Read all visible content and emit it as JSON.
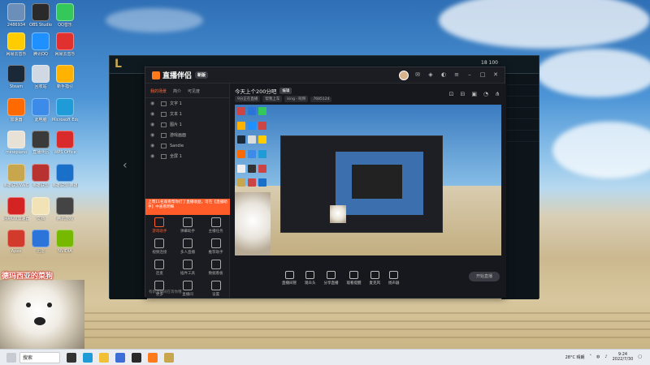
{
  "desktop": {
    "icons": [
      {
        "label": "2486934",
        "color": "#6b8fb8",
        "pos": "c1r1"
      },
      {
        "label": "OBS Studio",
        "color": "#2a2a2a",
        "pos": "c2r1"
      },
      {
        "label": "QQ音乐",
        "color": "#34c759",
        "pos": "c3r1"
      },
      {
        "label": "网易云音乐",
        "color": "#ffcc00",
        "pos": "c1r2"
      },
      {
        "label": "腾讯QQ",
        "color": "#1e90ff",
        "pos": "c2r2"
      },
      {
        "label": "网易云音乐",
        "color": "#e0312f",
        "pos": "c3r2"
      },
      {
        "label": "Steam",
        "color": "#1b2838",
        "pos": "c1r3"
      },
      {
        "label": "回收站",
        "color": "#cfd8e3",
        "pos": "c2r3"
      },
      {
        "label": "新手指引",
        "color": "#ffb300",
        "pos": "c3r3"
      },
      {
        "label": "加速器",
        "color": "#ff6a00",
        "pos": "c1r4"
      },
      {
        "label": "此电脑",
        "color": "#3d8be8",
        "pos": "c2r4"
      },
      {
        "label": "Microsoft Edge",
        "color": "#1f9bd8",
        "pos": "c3r4"
      },
      {
        "label": "minepiano",
        "color": "#e8e2d6",
        "pos": "c1r5"
      },
      {
        "label": "直播伴侣",
        "color": "#3a3a3a",
        "pos": "c2r5"
      },
      {
        "label": "WPS Office",
        "color": "#d92b2b",
        "pos": "c3r5"
      },
      {
        "label": "英雄联盟WeGame版",
        "color": "#c8a64e",
        "pos": "c1r6"
      },
      {
        "label": "英雄联盟",
        "color": "#b83232",
        "pos": "c2r6"
      },
      {
        "label": "英雄联盟·英雄时刻",
        "color": "#1a6fc9",
        "pos": "c3r6"
      },
      {
        "label": "网易UU加速器",
        "color": "#d42323",
        "pos": "c1r7"
      },
      {
        "label": "文档",
        "color": "#f2e3b6",
        "pos": "c2r7"
      },
      {
        "label": "腾讯游戏",
        "color": "#444",
        "pos": "c3r7"
      },
      {
        "label": "Apex",
        "color": "#d23b2b",
        "pos": "c1r8"
      },
      {
        "label": "迅雷",
        "color": "#2b74d9",
        "pos": "c2r8"
      },
      {
        "label": "NVIDIA",
        "color": "#76b900",
        "pos": "c3r8"
      }
    ]
  },
  "lol_client": {
    "logo": "L",
    "status": "18 100"
  },
  "app": {
    "brand": "直播伴侣",
    "version": "新版",
    "tabs": [
      "我的场景",
      "简介",
      "可见度"
    ],
    "scenes": [
      {
        "label": "文字 1"
      },
      {
        "label": "文本 1"
      },
      {
        "label": "图片 1"
      },
      {
        "label": "游戏画面"
      },
      {
        "label": "Sandie"
      },
      {
        "label": "全屏 1"
      }
    ],
    "promo": "上周11名观看帮你打了直播收益，可在【直播助手】中查看明细",
    "tools": [
      {
        "label": "游戏助手",
        "active": true
      },
      {
        "label": "弹幕助手",
        "active": false
      },
      {
        "label": "主播任务",
        "active": false
      },
      {
        "label": "视频连接",
        "active": false
      },
      {
        "label": "多人直播",
        "active": false
      },
      {
        "label": "推荐助手",
        "active": false
      },
      {
        "label": "连麦",
        "active": false
      },
      {
        "label": "插件工具",
        "active": false
      },
      {
        "label": "数据看板",
        "active": false
      },
      {
        "label": "更多",
        "active": false
      },
      {
        "label": "直播间",
        "active": false
      },
      {
        "label": "设置",
        "active": false
      }
    ],
    "footer": "有新直播间在等你哦",
    "room": {
      "title": "今天上个200分吧",
      "edit": "编辑",
      "tags": [
        "9分正在直播",
        "帮我上车",
        "king - 昵称",
        "7685124"
      ]
    },
    "bottom_tools": [
      "直播间管",
      "观众头",
      "分享直播",
      "观看提醒",
      "麦克风",
      "扬声器"
    ],
    "start_label": "开始直播"
  },
  "facecam": {
    "caption": "德玛西亚的菜狗"
  },
  "taskbar": {
    "search_placeholder": "搜索",
    "weather": "28°C 晴朗",
    "time": "9:24",
    "date": "2022/7/30"
  }
}
